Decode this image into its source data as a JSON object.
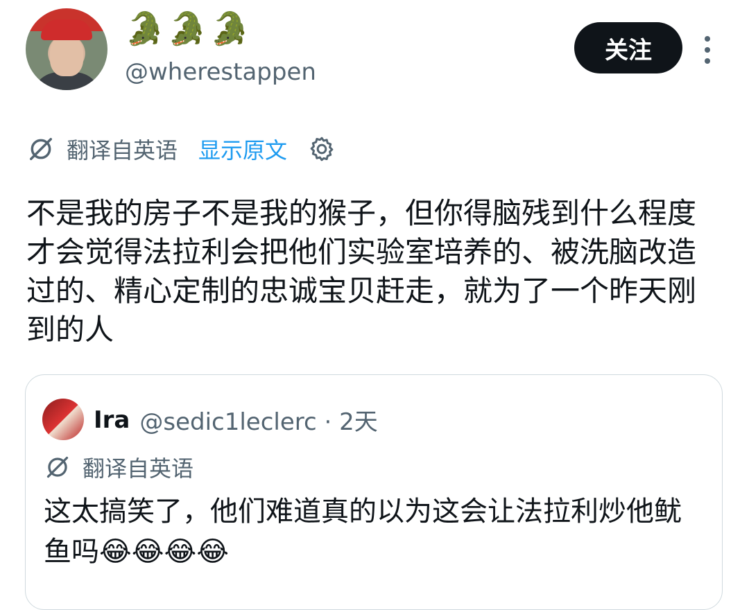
{
  "author": {
    "display_name": "🐊🐊🐊",
    "handle": "@wherestappen"
  },
  "follow_label": "关注",
  "translate": {
    "label": "翻译自英语",
    "show_original": "显示原文"
  },
  "tweet_text": "不是我的房子不是我的猴子，但你得脑残到什么程度才会觉得法拉利会把他们实验室培养的、被洗脑改造过的、精心定制的忠诚宝贝赶走，就为了一个昨天刚到的人",
  "quote": {
    "name": "Ira",
    "handle_time": "@sedic1leclerc · 2天",
    "translate_label": "翻译自英语",
    "text": "这太搞笑了，他们难道真的以为这会让法拉利炒他鱿鱼吗😂😂😂😂"
  },
  "icons": [
    "translate-icon",
    "gear-icon",
    "more-icon"
  ],
  "colors": {
    "accent": "#1d9bf0",
    "secondary_text": "#536471",
    "button_bg": "#0f1419"
  }
}
